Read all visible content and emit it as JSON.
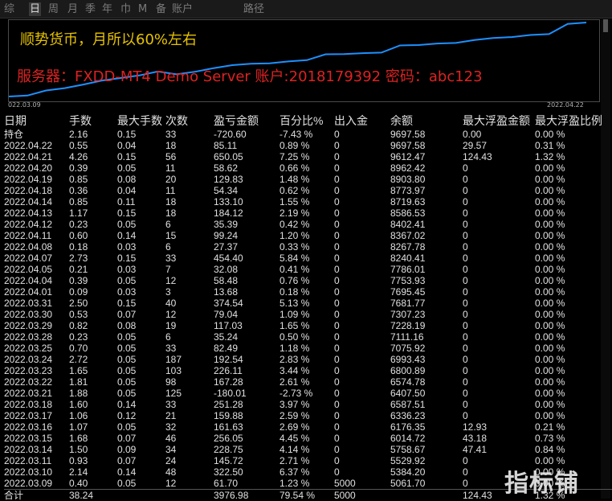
{
  "tabs": [
    "综",
    "日",
    "周",
    "月",
    "季",
    "年",
    "巾",
    "M",
    "备",
    "账户",
    "路径"
  ],
  "active_tab": 1,
  "headline": "顺势货币，月所以60%左右",
  "server_line": "服务器：FXDD-MT4 Demo Server    账户:2018179392   密码：abc123",
  "chart_data": {
    "type": "line",
    "x_start_label": "022.03.09",
    "x_end_label": "2022.04.22",
    "color": "#1e90ff",
    "y": [
      5000,
      5061.7,
      5384.2,
      5529.92,
      5758.67,
      6014.72,
      6176.35,
      6336.23,
      6587.51,
      6407.5,
      6574.78,
      6800.89,
      6993.43,
      7075.92,
      7111.16,
      7228.19,
      7307.23,
      7681.77,
      7695.45,
      7753.93,
      7786.01,
      8240.41,
      8267.78,
      8367.02,
      8402.41,
      8586.53,
      8719.63,
      8773.97,
      8903.8,
      8962.42,
      9612.47,
      9697.58
    ]
  },
  "table": {
    "headers": [
      "日期",
      "手数",
      "最大手数",
      "次数",
      "盈亏金额",
      "百分比%",
      "出入金",
      "余额",
      "最大浮盈金额",
      "最大浮盈比例"
    ],
    "holding": {
      "label": "持仓",
      "lots": "2.16",
      "maxlots": "0.15",
      "count": "33",
      "pnl": "-720.60",
      "pct": "-7.43 %",
      "io": "0",
      "bal": "9697.58",
      "mf": "0.00",
      "mfp": "0.00 %"
    },
    "rows": [
      [
        "2022.04.22",
        "0.55",
        "0.04",
        "18",
        "85.11",
        "0.89 %",
        "0",
        "9697.58",
        "29.57",
        "0.31 %"
      ],
      [
        "2022.04.21",
        "4.26",
        "0.15",
        "56",
        "650.05",
        "7.25 %",
        "0",
        "9612.47",
        "124.43",
        "1.32 %"
      ],
      [
        "2022.04.20",
        "0.39",
        "0.05",
        "11",
        "58.62",
        "0.66 %",
        "0",
        "8962.42",
        "0",
        "0.00 %"
      ],
      [
        "2022.04.19",
        "0.85",
        "0.08",
        "20",
        "129.83",
        "1.48 %",
        "0",
        "8903.80",
        "0",
        "0.00 %"
      ],
      [
        "2022.04.18",
        "0.36",
        "0.04",
        "11",
        "54.34",
        "0.62 %",
        "0",
        "8773.97",
        "0",
        "0.00 %"
      ],
      [
        "2022.04.14",
        "0.85",
        "0.11",
        "18",
        "133.10",
        "1.55 %",
        "0",
        "8719.63",
        "0",
        "0.00 %"
      ],
      [
        "2022.04.13",
        "1.17",
        "0.15",
        "18",
        "184.12",
        "2.19 %",
        "0",
        "8586.53",
        "0",
        "0.00 %"
      ],
      [
        "2022.04.12",
        "0.23",
        "0.05",
        "6",
        "35.39",
        "0.42 %",
        "0",
        "8402.41",
        "0",
        "0.00 %"
      ],
      [
        "2022.04.11",
        "0.60",
        "0.14",
        "15",
        "99.24",
        "1.20 %",
        "0",
        "8367.02",
        "0",
        "0.00 %"
      ],
      [
        "2022.04.08",
        "0.18",
        "0.03",
        "6",
        "27.37",
        "0.33 %",
        "0",
        "8267.78",
        "0",
        "0.00 %"
      ],
      [
        "2022.04.07",
        "2.73",
        "0.15",
        "33",
        "454.40",
        "5.84 %",
        "0",
        "8240.41",
        "0",
        "0.00 %"
      ],
      [
        "2022.04.05",
        "0.21",
        "0.03",
        "7",
        "32.08",
        "0.41 %",
        "0",
        "7786.01",
        "0",
        "0.00 %"
      ],
      [
        "2022.04.04",
        "0.39",
        "0.05",
        "12",
        "58.48",
        "0.76 %",
        "0",
        "7753.93",
        "0",
        "0.00 %"
      ],
      [
        "2022.04.01",
        "0.09",
        "0.03",
        "3",
        "13.68",
        "0.18 %",
        "0",
        "7695.45",
        "0",
        "0.00 %"
      ],
      [
        "2022.03.31",
        "2.50",
        "0.15",
        "40",
        "374.54",
        "5.13 %",
        "0",
        "7681.77",
        "0",
        "0.00 %"
      ],
      [
        "2022.03.30",
        "0.53",
        "0.07",
        "12",
        "79.04",
        "1.09 %",
        "0",
        "7307.23",
        "0",
        "0.00 %"
      ],
      [
        "2022.03.29",
        "0.82",
        "0.08",
        "19",
        "117.03",
        "1.65 %",
        "0",
        "7228.19",
        "0",
        "0.00 %"
      ],
      [
        "2022.03.28",
        "0.23",
        "0.05",
        "6",
        "35.24",
        "0.50 %",
        "0",
        "7111.16",
        "0",
        "0.00 %"
      ],
      [
        "2022.03.25",
        "0.70",
        "0.05",
        "33",
        "82.49",
        "1.18 %",
        "0",
        "7075.92",
        "0",
        "0.00 %"
      ],
      [
        "2022.03.24",
        "2.72",
        "0.05",
        "187",
        "192.54",
        "2.83 %",
        "0",
        "6993.43",
        "0",
        "0.00 %"
      ],
      [
        "2022.03.23",
        "1.65",
        "0.05",
        "103",
        "226.11",
        "3.44 %",
        "0",
        "6800.89",
        "0",
        "0.00 %"
      ],
      [
        "2022.03.22",
        "1.81",
        "0.05",
        "98",
        "167.28",
        "2.61 %",
        "0",
        "6574.78",
        "0",
        "0.00 %"
      ],
      [
        "2022.03.21",
        "1.88",
        "0.05",
        "125",
        "-180.01",
        "-2.73 %",
        "0",
        "6407.50",
        "0",
        "0.00 %"
      ],
      [
        "2022.03.18",
        "1.60",
        "0.14",
        "33",
        "251.28",
        "3.97 %",
        "0",
        "6587.51",
        "0",
        "0.00 %"
      ],
      [
        "2022.03.17",
        "1.06",
        "0.12",
        "21",
        "159.88",
        "2.59 %",
        "0",
        "6336.23",
        "0",
        "0.00 %"
      ],
      [
        "2022.03.16",
        "1.07",
        "0.05",
        "32",
        "161.63",
        "2.69 %",
        "0",
        "6176.35",
        "12.93",
        "0.21 %"
      ],
      [
        "2022.03.15",
        "1.68",
        "0.07",
        "46",
        "256.05",
        "4.45 %",
        "0",
        "6014.72",
        "43.18",
        "0.73 %"
      ],
      [
        "2022.03.14",
        "1.50",
        "0.09",
        "34",
        "228.75",
        "4.14 %",
        "0",
        "5758.67",
        "47.41",
        "0.84 %"
      ],
      [
        "2022.03.11",
        "0.93",
        "0.07",
        "24",
        "145.72",
        "2.71 %",
        "0",
        "5529.92",
        "0",
        "0.00 %"
      ],
      [
        "2022.03.10",
        "2.14",
        "0.14",
        "48",
        "322.50",
        "6.37 %",
        "0",
        "5384.20",
        "0",
        "0.00 %"
      ],
      [
        "2022.03.09",
        "0.40",
        "0.05",
        "12",
        "61.70",
        "1.23 %",
        "5000",
        "5061.70",
        "0",
        "0.00 %"
      ]
    ],
    "total": {
      "label": "合计",
      "lots": "38.24",
      "pnl": "3976.98",
      "pct": "79.54 %",
      "io": "5000",
      "mf": "124.43",
      "mfp": "1.32 %"
    }
  },
  "watermark": "指标铺"
}
